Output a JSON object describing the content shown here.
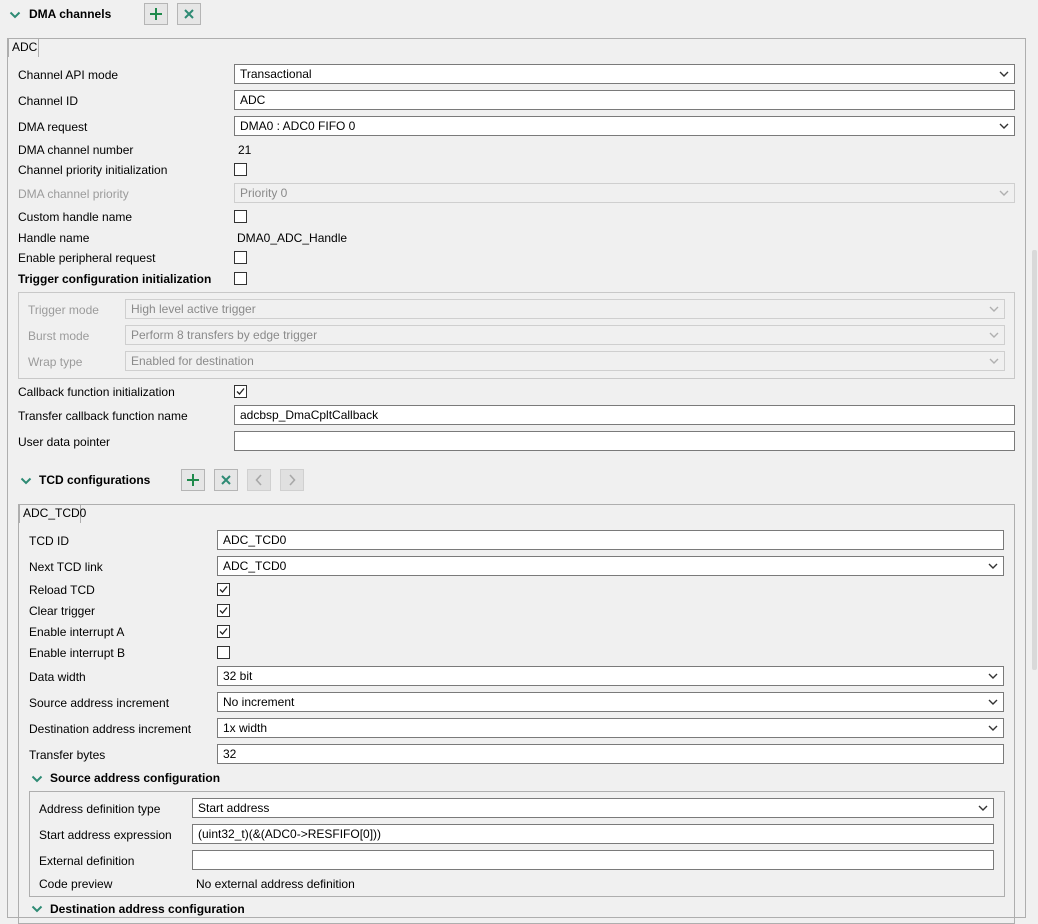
{
  "dma_section": {
    "title": "DMA channels"
  },
  "tabs": {
    "adc": "ADC"
  },
  "channel": {
    "api_mode_label": "Channel API mode",
    "api_mode_value": "Transactional",
    "channel_id_label": "Channel ID",
    "channel_id_value": "ADC",
    "dma_request_label": "DMA request",
    "dma_request_value": "DMA0 : ADC0 FIFO 0",
    "channel_number_label": "DMA channel number",
    "channel_number_value": "21",
    "priority_init_label": "Channel priority initialization",
    "priority_label": "DMA channel priority",
    "priority_value": "Priority 0",
    "custom_handle_label": "Custom handle name",
    "handle_name_label": "Handle name",
    "handle_name_value": "DMA0_ADC_Handle",
    "enable_periph_label": "Enable peripheral request",
    "trigger_init_label": "Trigger configuration initialization",
    "trigger_mode_label": "Trigger mode",
    "trigger_mode_value": "High level active trigger",
    "burst_mode_label": "Burst mode",
    "burst_mode_value": "Perform 8 transfers by edge trigger",
    "wrap_type_label": "Wrap type",
    "wrap_type_value": "Enabled for destination",
    "callback_init_label": "Callback function initialization",
    "callback_name_label": "Transfer callback function name",
    "callback_name_value": "adcbsp_DmaCpltCallback",
    "user_data_label": "User data pointer",
    "user_data_value": ""
  },
  "tcd_section": {
    "title": "TCD configurations",
    "tab": "ADC_TCD0"
  },
  "tcd": {
    "id_label": "TCD ID",
    "id_value": "ADC_TCD0",
    "next_link_label": "Next TCD link",
    "next_link_value": "ADC_TCD0",
    "reload_label": "Reload TCD",
    "clear_trigger_label": "Clear trigger",
    "int_a_label": "Enable interrupt A",
    "int_b_label": "Enable interrupt B",
    "data_width_label": "Data width",
    "data_width_value": "32 bit",
    "src_inc_label": "Source address increment",
    "src_inc_value": "No increment",
    "dst_inc_label": "Destination address increment",
    "dst_inc_value": "1x width",
    "transfer_bytes_label": "Transfer bytes",
    "transfer_bytes_value": "32"
  },
  "src_addr": {
    "title": "Source address configuration",
    "def_type_label": "Address definition type",
    "def_type_value": "Start address",
    "start_expr_label": "Start address expression",
    "start_expr_value": "(uint32_t)(&(ADC0->RESFIFO[0]))",
    "ext_def_label": "External definition",
    "ext_def_value": "",
    "preview_label": "Code preview",
    "preview_value": "No external address definition"
  },
  "dst_addr": {
    "title": "Destination address configuration"
  },
  "colors": {
    "accent": "#2e8b74",
    "plus": "#1f8a4c"
  }
}
